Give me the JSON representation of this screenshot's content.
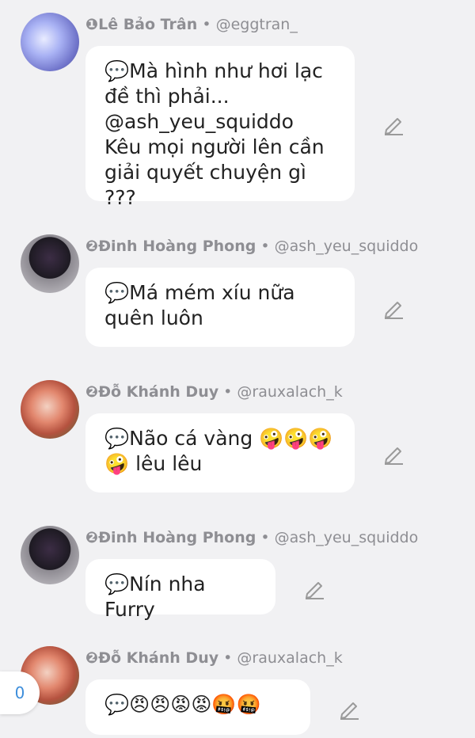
{
  "comments": [
    {
      "rank": "❶",
      "name": "Lê Bảo Trân",
      "handle": "@eggtran_",
      "text": "💬Mà hình như hơi lạc đề thì phải... @ash_yeu_squiddo Kêu mọi người lên cần giải quyết chuyện gì ???"
    },
    {
      "rank": "❷",
      "name": "Đinh Hoàng Phong",
      "handle": "@ash_yeu_squiddo",
      "text": "💬Má mém xíu nữa quên luôn"
    },
    {
      "rank": "❷",
      "name": "Đỗ Khánh Duy",
      "handle": "@rauxalach_k",
      "text": "💬Não cá vàng 🤪🤪🤪🤪 lêu lêu"
    },
    {
      "rank": "❷",
      "name": "Đinh Hoàng Phong",
      "handle": "@ash_yeu_squiddo",
      "text": "💬Nín nha Furry"
    },
    {
      "rank": "❷",
      "name": "Đỗ Khánh Duy",
      "handle": "@rauxalach_k",
      "text": "💬😠😠😡😡🤬🤬"
    }
  ],
  "separator": "•",
  "fab": {
    "label": "0"
  },
  "icons": {
    "edit": "pencil-icon",
    "speech": "speech-bubble-icon"
  }
}
